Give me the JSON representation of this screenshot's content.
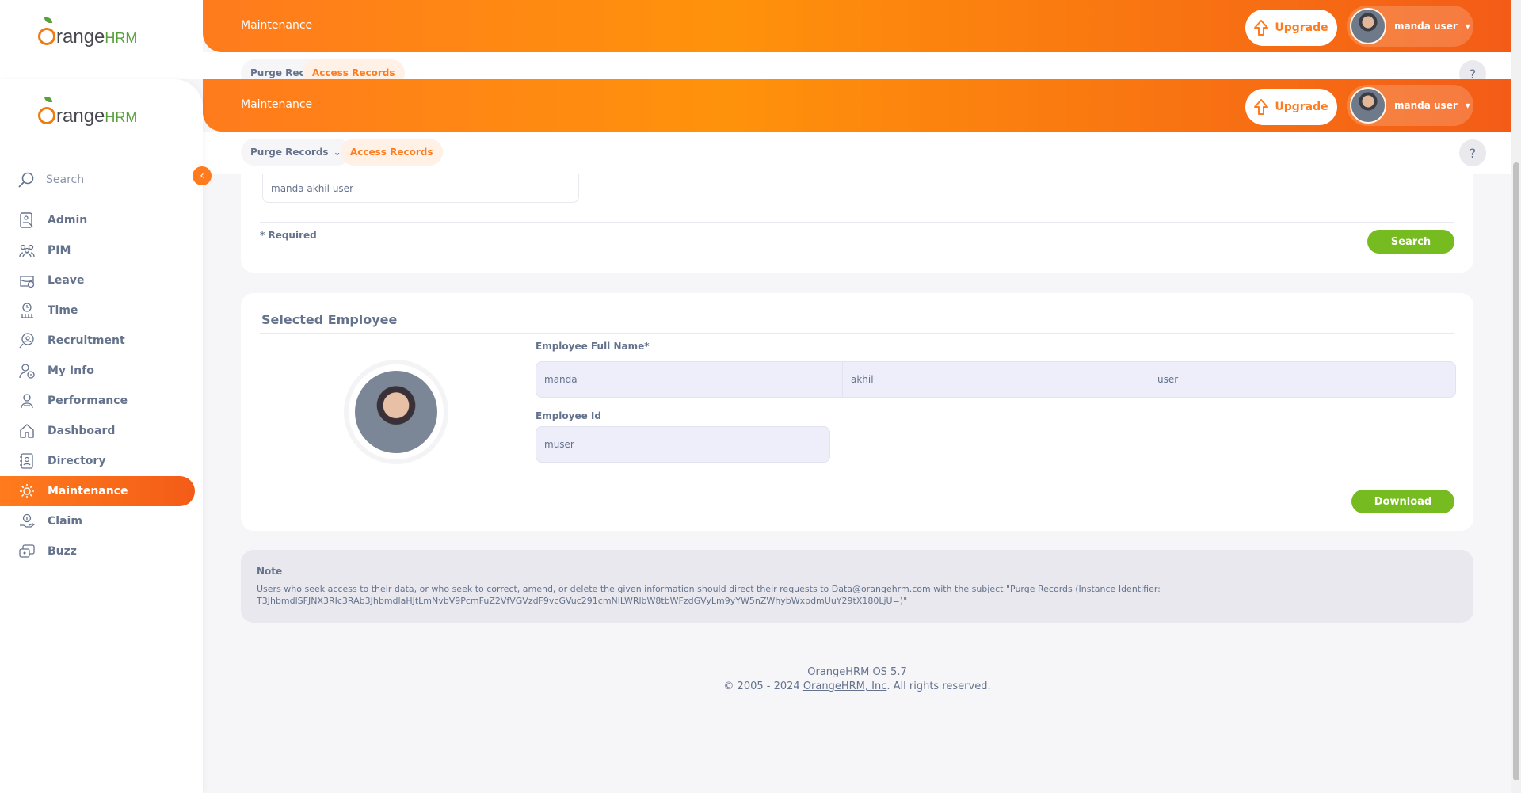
{
  "app": {
    "logo_main": "range",
    "logo_suffix": "HRM"
  },
  "header": {
    "breadcrumb": "Maintenance",
    "upgrade_label": "Upgrade",
    "user_name": "manda user"
  },
  "tabs": {
    "purge": "Purge Records",
    "access": "Access Records",
    "help": "?"
  },
  "sidebar": {
    "search_placeholder": "Search",
    "items": [
      {
        "label": "Admin",
        "icon": "admin-icon"
      },
      {
        "label": "PIM",
        "icon": "pim-icon"
      },
      {
        "label": "Leave",
        "icon": "leave-icon"
      },
      {
        "label": "Time",
        "icon": "time-icon"
      },
      {
        "label": "Recruitment",
        "icon": "recruitment-icon"
      },
      {
        "label": "My Info",
        "icon": "myinfo-icon"
      },
      {
        "label": "Performance",
        "icon": "performance-icon"
      },
      {
        "label": "Dashboard",
        "icon": "dashboard-icon"
      },
      {
        "label": "Directory",
        "icon": "directory-icon"
      },
      {
        "label": "Maintenance",
        "icon": "maintenance-icon"
      },
      {
        "label": "Claim",
        "icon": "claim-icon"
      },
      {
        "label": "Buzz",
        "icon": "buzz-icon"
      }
    ],
    "active": "Maintenance"
  },
  "search_card": {
    "employee_value": "manda akhil user",
    "required_note": "* Required",
    "search_button": "Search"
  },
  "selected_employee": {
    "title": "Selected Employee",
    "full_name_label": "Employee Full Name*",
    "first_name": "manda",
    "middle_name": "akhil",
    "last_name": "user",
    "employee_id_label": "Employee Id",
    "employee_id": "muser",
    "download_button": "Download"
  },
  "note": {
    "title": "Note",
    "text_line1": "Users who seek access to their data, or who seek to correct, amend, or delete the given information should direct their requests to Data@orangehrm.com with the subject \"Purge Records (Instance Identifier:",
    "text_line2": "T3JhbmdlSFJNX3RIc3RAb3JhbmdlaHJtLmNvbV9PcmFuZ2VfVGVzdF9vcGVuc291cmNlLWRlbW8tbWFzdGVyLm9yYW5nZWhybWxpdmUuY29tX180LjU=)\""
  },
  "footer": {
    "version": "OrangeHRM OS 5.7",
    "copyright_prefix": "© 2005 - 2024 ",
    "company_link": "OrangeHRM, Inc",
    "copyright_suffix": ". All rights reserved."
  },
  "colors": {
    "brand_orange": "#ff7b1d",
    "green": "#76bc21",
    "text": "#64728c"
  }
}
